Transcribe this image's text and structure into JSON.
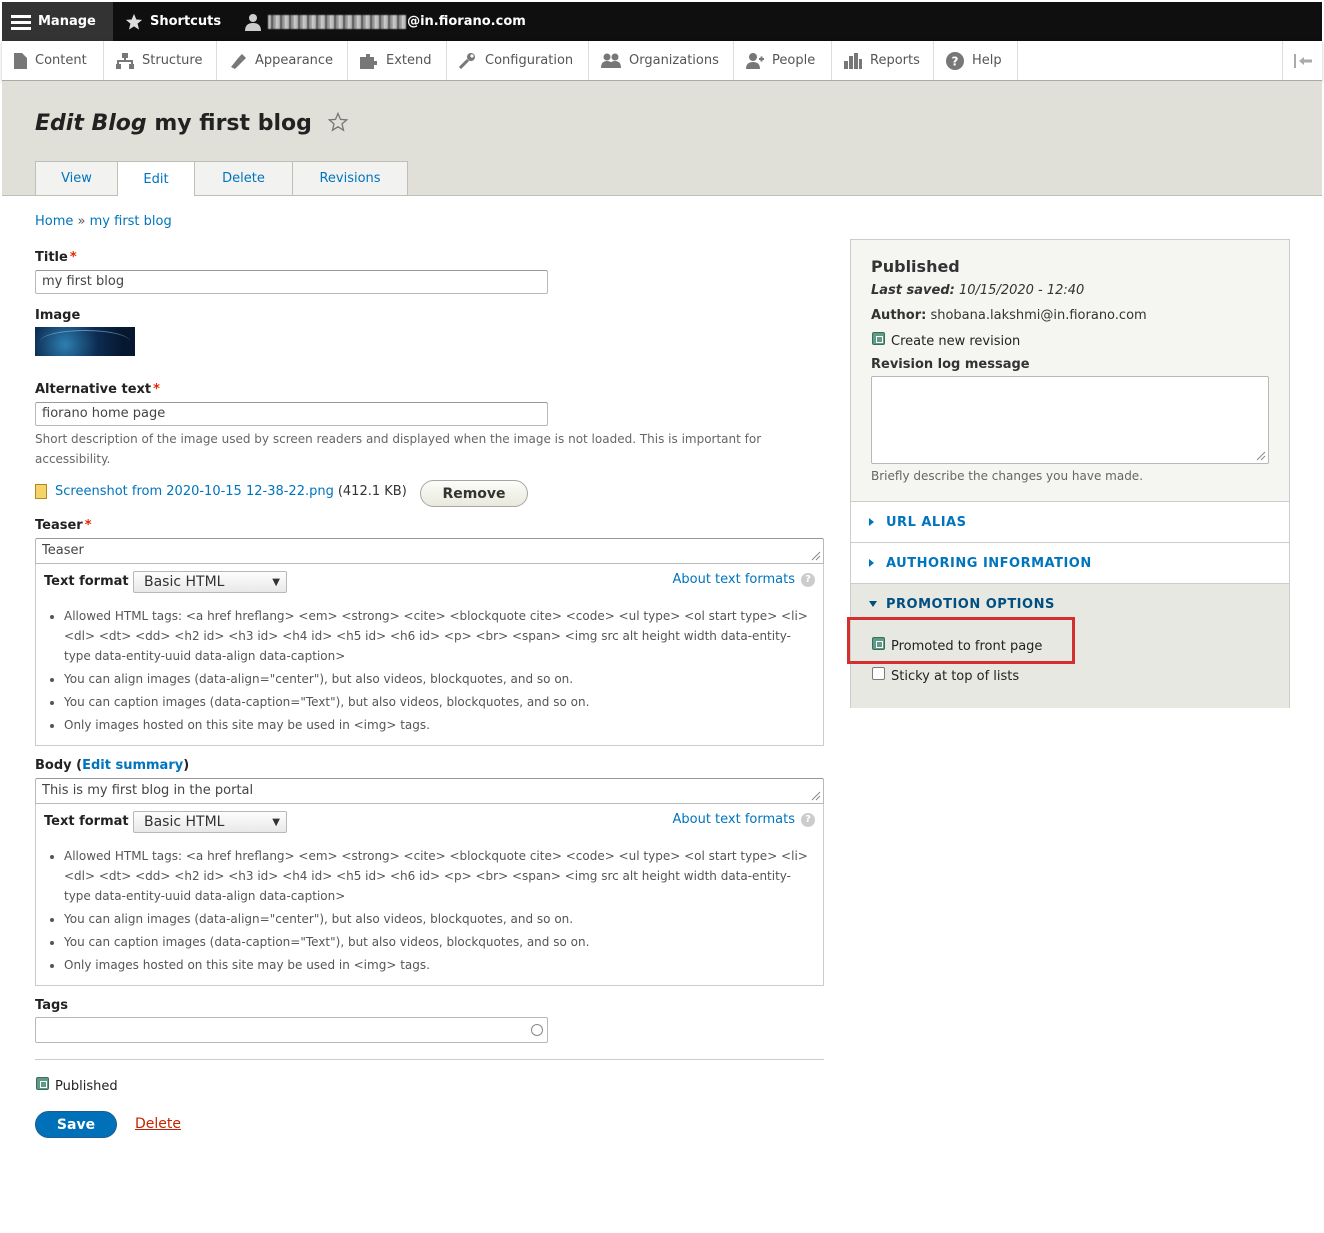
{
  "toolbar": {
    "manage": "Manage",
    "shortcuts": "Shortcuts",
    "user_domain": "@in.fiorano.com"
  },
  "tray": {
    "items": [
      "Content",
      "Structure",
      "Appearance",
      "Extend",
      "Configuration",
      "Organizations",
      "People",
      "Reports",
      "Help"
    ]
  },
  "header": {
    "title_prefix": "Edit Blog",
    "title_name": "my first blog",
    "tabs": [
      "View",
      "Edit",
      "Delete",
      "Revisions"
    ]
  },
  "breadcrumb": {
    "home": "Home",
    "sep": "»",
    "current": "my first blog"
  },
  "form": {
    "title_label": "Title",
    "title_value": "my first blog",
    "image_label": "Image",
    "alt_label": "Alternative text",
    "alt_value": "fiorano home page",
    "alt_desc": "Short description of the image used by screen readers and displayed when the image is not loaded. This is important for accessibility.",
    "file_name": "Screenshot from 2020-10-15 12-38-22.png",
    "file_size": "(412.1 KB)",
    "remove_label": "Remove",
    "teaser_label": "Teaser",
    "teaser_value": "Teaser",
    "text_format_label": "Text format",
    "text_format_value": "Basic HTML",
    "about_formats": "About text formats",
    "tips": [
      "Allowed HTML tags: <a href hreflang> <em> <strong> <cite> <blockquote cite> <code> <ul type> <ol start type> <li> <dl> <dt> <dd> <h2 id> <h3 id> <h4 id> <h5 id> <h6 id> <p> <br> <span> <img src alt height width data-entity-type data-entity-uuid data-align data-caption>",
      "You can align images (data-align=\"center\"), but also videos, blockquotes, and so on.",
      "You can caption images (data-caption=\"Text\"), but also videos, blockquotes, and so on.",
      "Only images hosted on this site may be used in <img> tags."
    ],
    "body_label": "Body",
    "edit_summary": "Edit summary",
    "body_value": "This is my first blog in the portal",
    "tags_label": "Tags",
    "published_label": "Published",
    "save_label": "Save",
    "delete_label": "Delete"
  },
  "sidebar": {
    "status": "Published",
    "last_saved_label": "Last saved:",
    "last_saved_value": "10/15/2020 - 12:40",
    "author_label": "Author:",
    "author_value": "shobana.lakshmi@in.fiorano.com",
    "create_revision": "Create new revision",
    "revision_log_label": "Revision log message",
    "revision_log_desc": "Briefly describe the changes you have made.",
    "url_alias": "URL ALIAS",
    "authoring_info": "AUTHORING INFORMATION",
    "promotion_options": "PROMOTION OPTIONS",
    "promoted": "Promoted to front page",
    "sticky": "Sticky at top of lists"
  },
  "colors": {
    "link": "#0074bd",
    "save_button": "#0071b8",
    "delete_link": "#c72100",
    "required": "#e62600",
    "highlight": "#d32f2f"
  },
  "icons": [
    "hamburger-icon",
    "star-icon",
    "user-icon",
    "content-icon",
    "structure-icon",
    "appearance-icon",
    "extend-icon",
    "configuration-icon",
    "organizations-icon",
    "people-icon",
    "reports-icon",
    "help-icon",
    "collapse-tray-icon",
    "file-icon",
    "autocomplete-icon"
  ]
}
